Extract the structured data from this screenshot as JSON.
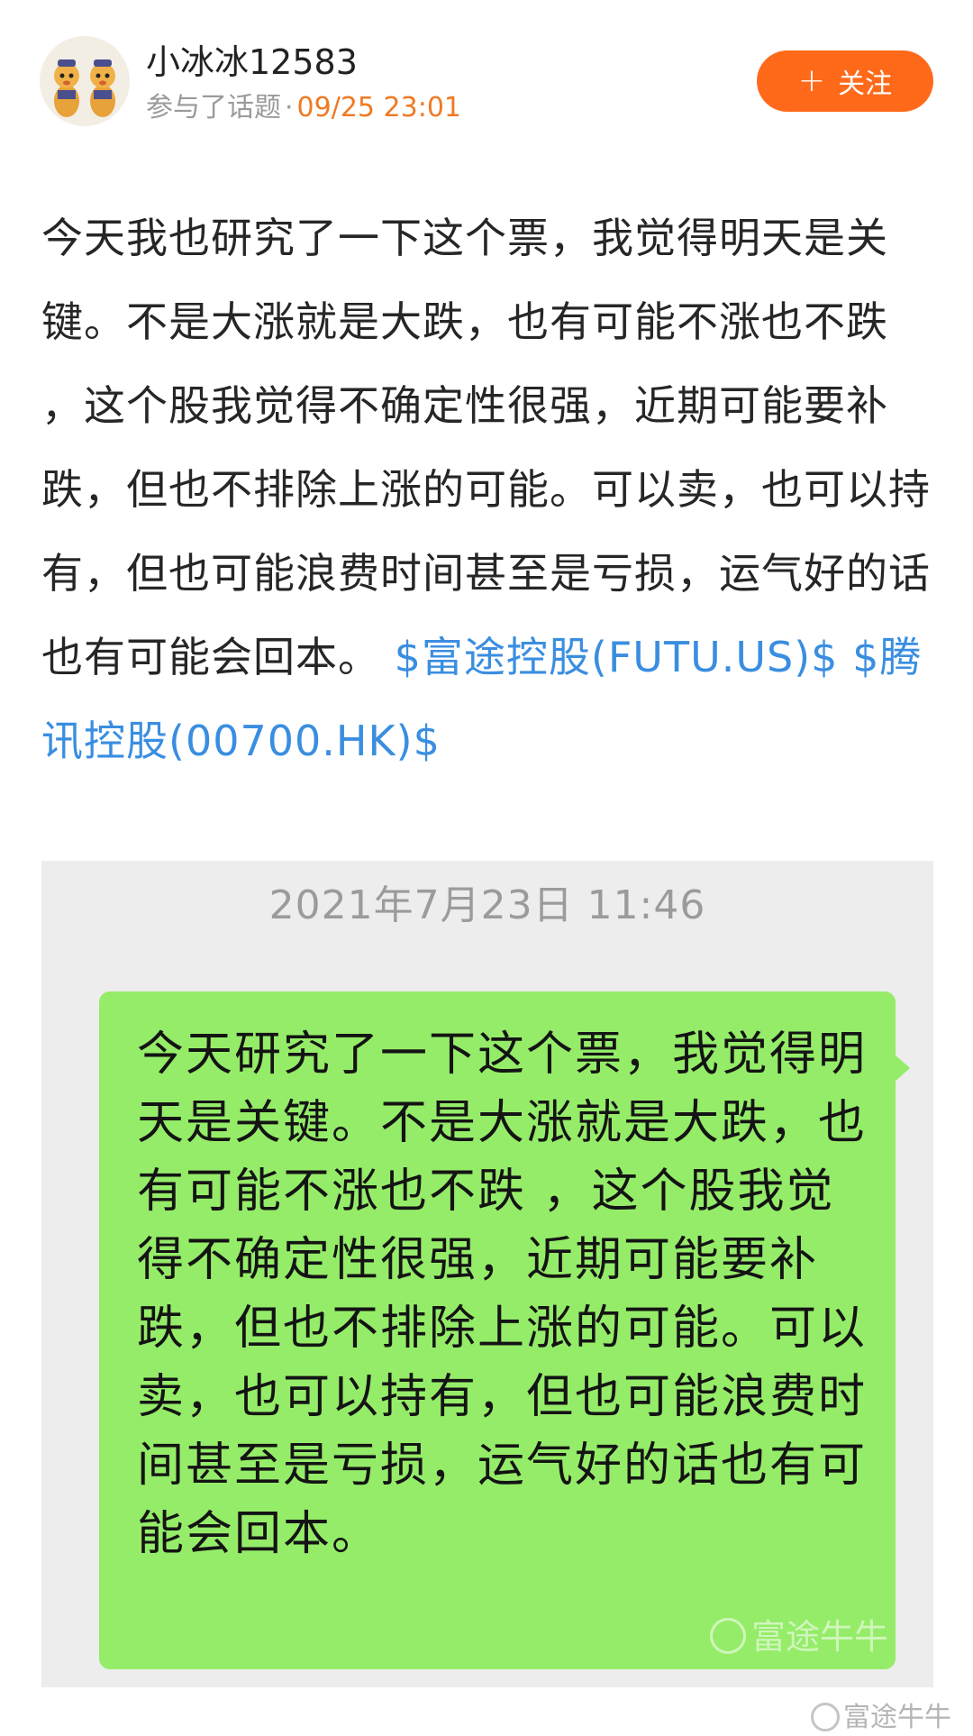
{
  "post": {
    "author": {
      "name": "小冰冰12583",
      "avatar_icon": "cartoon-mascot-avatar"
    },
    "meta": {
      "topic_text": "参与了话题",
      "separator": "·",
      "timestamp": "09/25 23:01"
    },
    "follow_button": {
      "icon": "+",
      "label": "关注"
    },
    "body": {
      "text": "今天我也研究了一下这个票，我觉得明天是关键。不是大涨就是大跌，也有可能不涨也不跌 ，这个股我觉得不确定性很强，近期可能要补跌，但也不排除上涨的可能。可以卖，也可以持有，但也可能浪费时间甚至是亏损，运气好的话也有可能会回本。",
      "stock_links": [
        "$富途控股(FUTU.US)$",
        "$腾讯控股(00700.HK)$"
      ]
    }
  },
  "chat_screenshot": {
    "time": "2021年7月23日 11:46",
    "message": "今天研究了一下这个票，我觉得明天是关键。不是大涨就是大跌，也有可能不涨也不跌 ，这个股我觉得不确定性很强，近期可能要补跌，但也不排除上涨的可能。可以卖，也可以持有，但也可能浪费时间甚至是亏损，运气好的话也有可能会回本。",
    "watermark": "富途牛牛"
  },
  "page_watermark": "富途牛牛",
  "colors": {
    "accent_orange": "#ff6a1a",
    "timestamp_orange": "#f07a24",
    "link_blue": "#3a8ee0",
    "bubble_green": "#95ec69",
    "chat_background": "#ededed"
  }
}
